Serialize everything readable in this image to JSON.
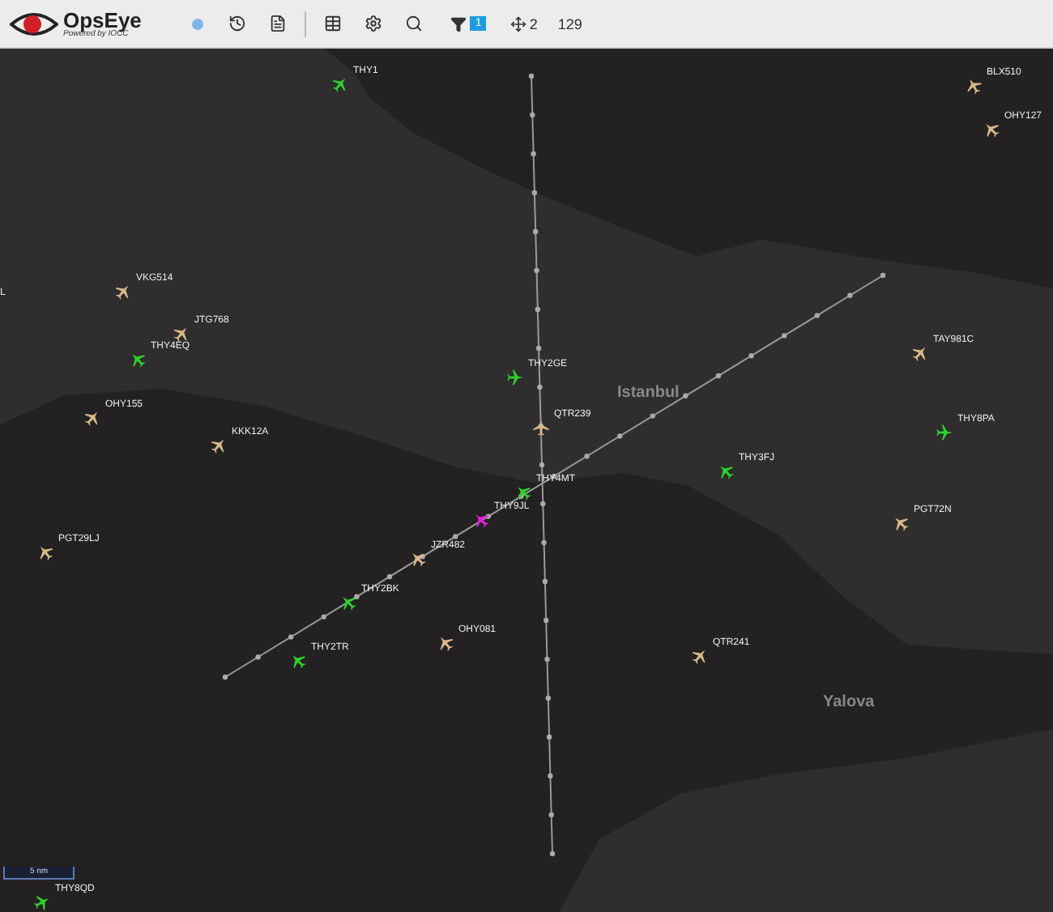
{
  "toolbar": {
    "brand": "OpsEye",
    "tagline": "Powered by IOCC",
    "filter_count": "1",
    "target_count": "2",
    "total": "129"
  },
  "map": {
    "places": [
      "Istanbul",
      "Yalova"
    ],
    "edge_label": "L",
    "scale": "5 nm",
    "aircraft": [
      {
        "label": "THY1",
        "color": "#2ed12e"
      },
      {
        "label": "BLX510",
        "color": "#d9b98a"
      },
      {
        "label": "OHY127",
        "color": "#d9b98a"
      },
      {
        "label": "VKG514",
        "color": "#d9b98a"
      },
      {
        "label": "JTG768",
        "color": "#d9b98a"
      },
      {
        "label": "THY4EQ",
        "color": "#2ed12e"
      },
      {
        "label": "TAY981C",
        "color": "#d9b98a"
      },
      {
        "label": "THY2GE",
        "color": "#2ed12e"
      },
      {
        "label": "QTR239",
        "color": "#d9b98a"
      },
      {
        "label": "OHY155",
        "color": "#d9b98a"
      },
      {
        "label": "THY8PA",
        "color": "#2ed12e"
      },
      {
        "label": "KKK12A",
        "color": "#d9b98a"
      },
      {
        "label": "THY3FJ",
        "color": "#2ed12e"
      },
      {
        "label": "THY4MT",
        "color": "#2ed12e"
      },
      {
        "label": "THY9JL",
        "color": "#e01ee0"
      },
      {
        "label": "PGT72N",
        "color": "#d9b98a"
      },
      {
        "label": "PGT29LJ",
        "color": "#d9b98a"
      },
      {
        "label": "JZR482",
        "color": "#d9b98a"
      },
      {
        "label": "THY2BK",
        "color": "#2ed12e"
      },
      {
        "label": "OHY081",
        "color": "#d9b98a"
      },
      {
        "label": "QTR241",
        "color": "#d9b98a"
      },
      {
        "label": "THY2TR",
        "color": "#2ed12e"
      },
      {
        "label": "THY8QD",
        "color": "#2ed12e"
      }
    ]
  }
}
